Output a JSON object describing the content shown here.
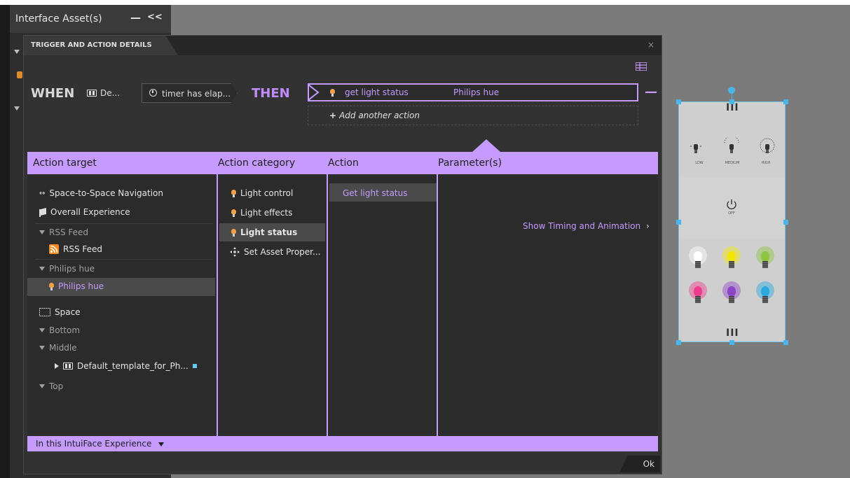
{
  "assets_panel": {
    "title": "Interface Asset(s)",
    "minimize": "—",
    "collapse": "<<"
  },
  "dialog": {
    "tab": "TRIGGER AND ACTION DETAILS",
    "close": "×",
    "when_label": "WHEN",
    "trigger_source": "De...",
    "trigger_event": "timer has elap...",
    "then_label": "THEN",
    "action_name": "get light status",
    "action_target": "Philips hue",
    "remove_action": "—",
    "add_action": "Add another action",
    "add_action_plus": "+",
    "ok": "Ok"
  },
  "columns": {
    "target": "Action target",
    "category": "Action category",
    "action": "Action",
    "params": "Parameter(s)"
  },
  "targets": {
    "nav": "Space-to-Space Navigation",
    "overall": "Overall Experience",
    "rss_group": "RSS Feed",
    "rss_item": "RSS Feed",
    "hue_group": "Philips hue",
    "hue_item": "Philips hue",
    "space": "Space",
    "bottom": "Bottom",
    "middle": "Middle",
    "template": "Default_template_for_Ph...",
    "top": "Top"
  },
  "categories": [
    "Light control",
    "Light effects",
    "Light status",
    "Set Asset Proper..."
  ],
  "actions": [
    "Get light status"
  ],
  "show_timing": "Show Timing and Animation",
  "footer": "In this IntuiFace Experience",
  "widget": {
    "levels": [
      "LOW",
      "MEDIUM",
      "HIGH"
    ],
    "power_label": "OFF",
    "bulb_colors": [
      "#ffffff",
      "#f2e600",
      "#8cc63f",
      "#ee3d8d",
      "#8e44c9",
      "#29a8e0"
    ]
  },
  "colors": {
    "accent": "#c59bff",
    "selection_handles": "#4ab5e8"
  }
}
